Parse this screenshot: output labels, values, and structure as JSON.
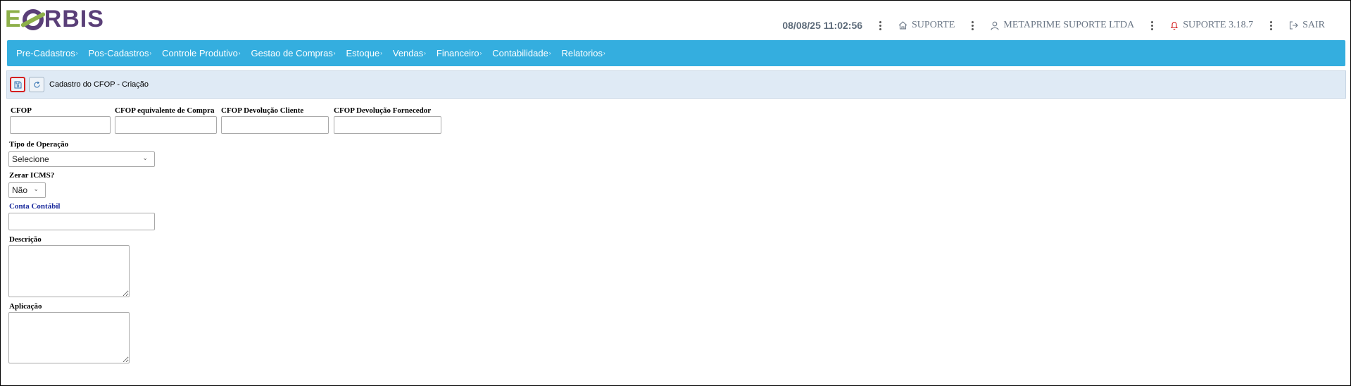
{
  "logo": {
    "part1": "E",
    "part2": "RBIS"
  },
  "header": {
    "datetime": "08/08/25 11:02:56",
    "home_label": "SUPORTE",
    "company_label": "METAPRIME SUPORTE LTDA",
    "notif_label": "SUPORTE 3.18.7",
    "logout_label": "SAIR"
  },
  "menu": {
    "items": [
      {
        "label": "Pre-Cadastros"
      },
      {
        "label": "Pos-Cadastros"
      },
      {
        "label": "Controle Produtivo"
      },
      {
        "label": "Gestao de Compras"
      },
      {
        "label": "Estoque"
      },
      {
        "label": "Vendas"
      },
      {
        "label": "Financeiro"
      },
      {
        "label": "Contabilidade"
      },
      {
        "label": "Relatorios"
      }
    ],
    "caret": "›"
  },
  "toolbar": {
    "title": "Cadastro do CFOP - Criação"
  },
  "form": {
    "cfop_label": "CFOP",
    "cfop_compra_label": "CFOP equivalente de Compra",
    "cfop_dev_cliente_label": "CFOP Devolução Cliente",
    "cfop_dev_fornecedor_label": "CFOP Devolução Fornecedor",
    "tipo_operacao_label": "Tipo de Operação",
    "tipo_operacao_value": "Selecione",
    "zerar_icms_label": "Zerar ICMS?",
    "zerar_icms_value": "Não",
    "conta_contabil_label": "Conta Contábil",
    "descricao_label": "Descrição",
    "aplicacao_label": "Aplicação"
  },
  "colors": {
    "menu_bg": "#34aedf",
    "toolbar_bg": "#dfeaf5",
    "save_highlight": "#d42020",
    "logo_green": "#8db04a",
    "logo_purple": "#5a3f78"
  }
}
